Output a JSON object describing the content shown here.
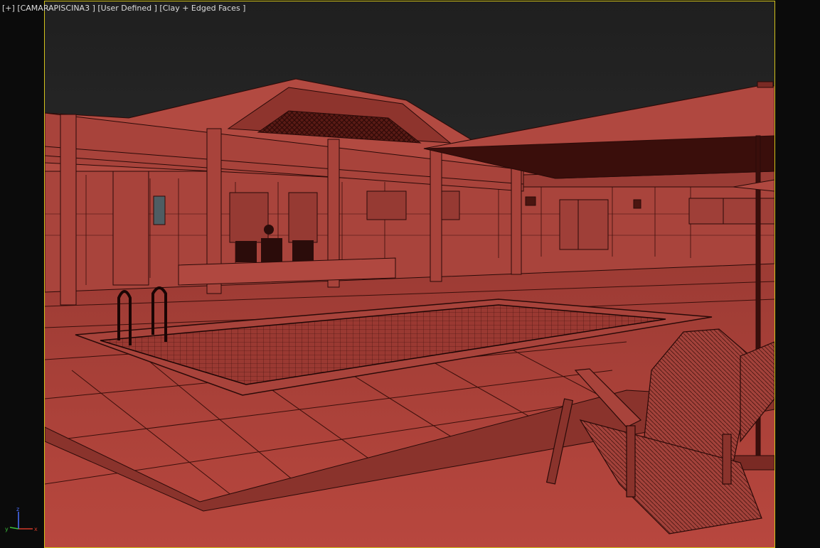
{
  "viewport": {
    "menu_plus": "[+]",
    "camera_name": "[CAMARAPISCINA3 ]",
    "view_mode": "[User Defined ]",
    "shading_mode": "[Clay + Edged Faces ]",
    "active_border_color": "#d2c21c",
    "clay_color": "#b5473e",
    "edge_color": "#2a0a08",
    "sky_color": "#262626"
  },
  "axis_gizmo": {
    "x_label": "x",
    "y_label": "y",
    "z_label": "z",
    "x_color": "#d23a2a",
    "y_color": "#3bbf3b",
    "z_color": "#4b6fff"
  }
}
